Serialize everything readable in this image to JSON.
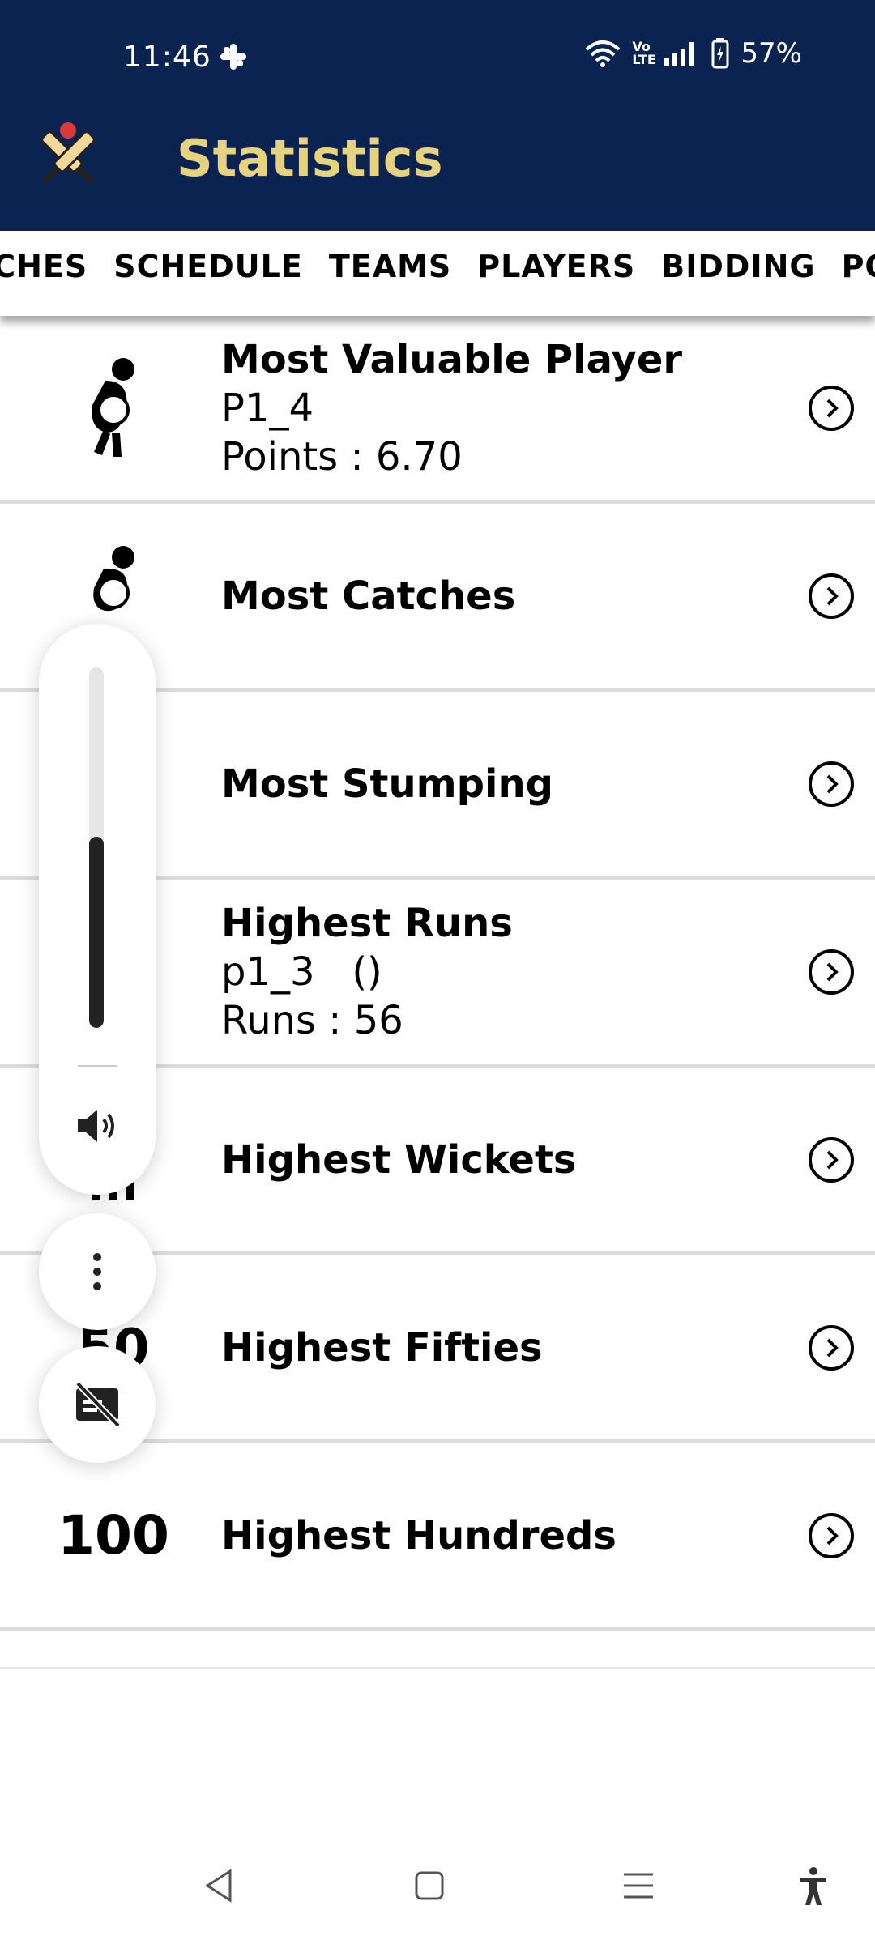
{
  "status_bar": {
    "time": "11:46",
    "network_label": "Vo LTE",
    "battery": "57%"
  },
  "app": {
    "title": "Statistics",
    "brand_color": "#0b2350",
    "title_color": "#e7d37d"
  },
  "tabs": [
    {
      "label": "MATCHES"
    },
    {
      "label": "SCHEDULE"
    },
    {
      "label": "TEAMS"
    },
    {
      "label": "PLAYERS"
    },
    {
      "label": "BIDDING"
    },
    {
      "label": "POINTS"
    }
  ],
  "stats": [
    {
      "title": "Most Valuable Player",
      "line1": "P1_4",
      "line2": "Points : 6.70",
      "icon": "batsman-icon"
    },
    {
      "title": "Most Catches",
      "line1": "",
      "line2": "",
      "icon": "fielder-icon"
    },
    {
      "title": "Most Stumping",
      "line1": "",
      "line2": "",
      "icon": "wicketkeeper-icon"
    },
    {
      "title": "Highest Runs",
      "line1": "p1_3   ()",
      "line2": "Runs : 56",
      "icon": "bat-icon"
    },
    {
      "title": "Highest Wickets",
      "line1": "",
      "line2": "",
      "icon": "stumps-icon"
    },
    {
      "title": "Highest Fifties",
      "line1": "",
      "line2": "",
      "icon": "fifty-icon"
    },
    {
      "title": "Highest Hundreds",
      "line1": "",
      "line2": "",
      "icon": "hundred-icon",
      "badge": "100"
    }
  ],
  "volume": {
    "level": 0.53
  }
}
